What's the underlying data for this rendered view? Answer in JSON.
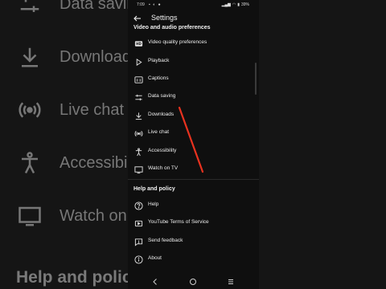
{
  "background": {
    "items": [
      {
        "label": "Data saving",
        "icon": "sliders-icon"
      },
      {
        "label": "Downloads",
        "icon": "download-icon"
      },
      {
        "label": "Live chat",
        "icon": "live-icon"
      },
      {
        "label": "Accessibility",
        "icon": "accessibility-icon"
      },
      {
        "label": "Watch on TV",
        "icon": "tv-icon"
      }
    ],
    "heading": "Help and policy"
  },
  "status_bar": {
    "time": "7:09",
    "battery": "39%"
  },
  "app_bar": {
    "title": "Settings"
  },
  "sections": [
    {
      "title": "Video and audio preferences",
      "items": [
        {
          "label": "Video quality preferences",
          "icon": "hd-icon"
        },
        {
          "label": "Playback",
          "icon": "play-icon"
        },
        {
          "label": "Captions",
          "icon": "captions-icon"
        },
        {
          "label": "Data saving",
          "icon": "sliders-icon"
        },
        {
          "label": "Downloads",
          "icon": "download-icon"
        },
        {
          "label": "Live chat",
          "icon": "live-icon"
        },
        {
          "label": "Accessibility",
          "icon": "accessibility-icon"
        },
        {
          "label": "Watch on TV",
          "icon": "tv-icon"
        }
      ]
    },
    {
      "title": "Help and policy",
      "items": [
        {
          "label": "Help",
          "icon": "help-icon"
        },
        {
          "label": "YouTube Terms of Service",
          "icon": "terms-icon"
        },
        {
          "label": "Send feedback",
          "icon": "feedback-icon"
        },
        {
          "label": "About",
          "icon": "info-icon"
        }
      ]
    }
  ],
  "colors": {
    "background": "#0f0f0f",
    "text": "#f1f1f1",
    "annotation": "#e8321f"
  }
}
